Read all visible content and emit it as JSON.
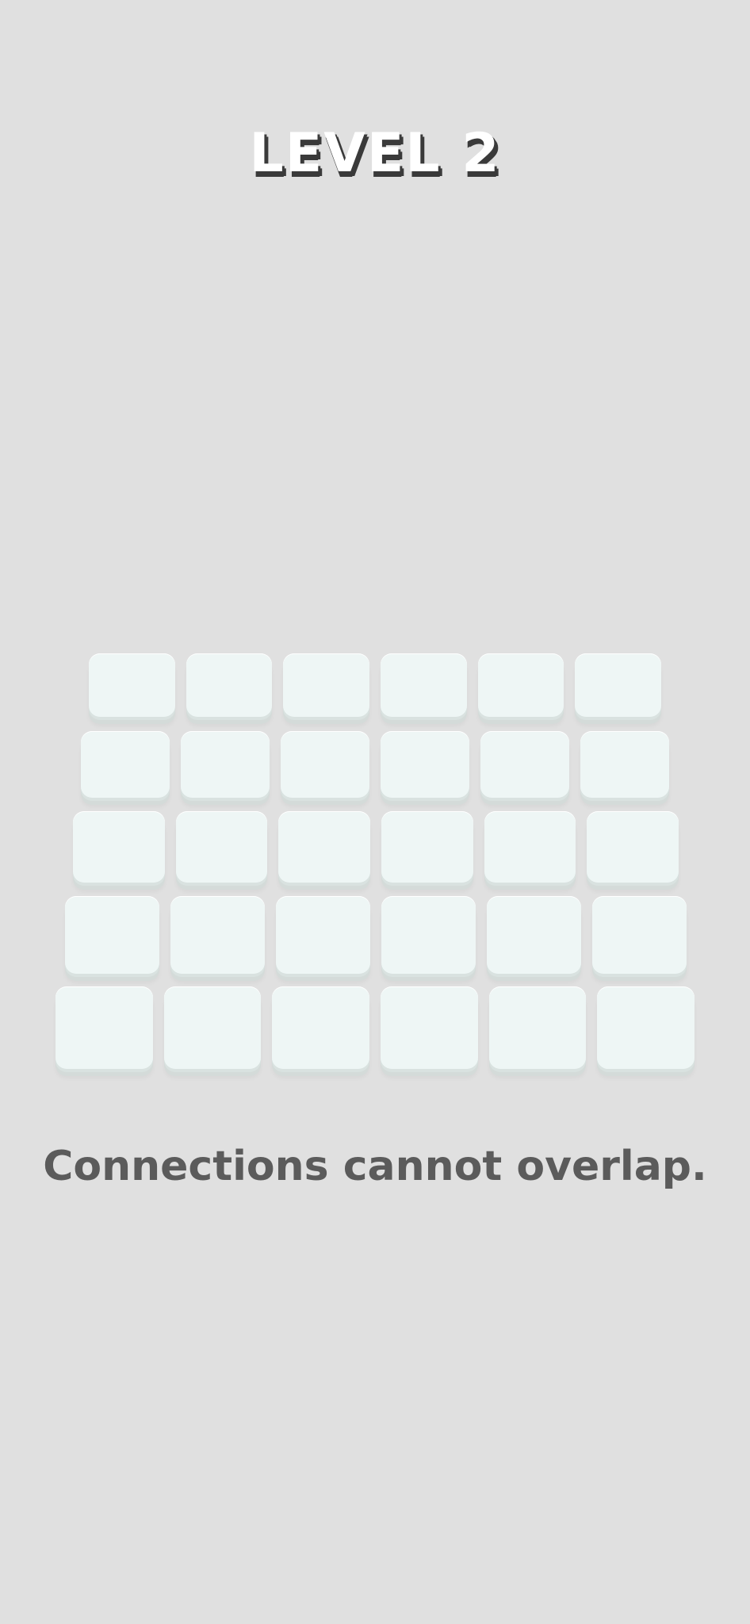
{
  "level": {
    "title": "LEVEL 2"
  },
  "board": {
    "rows": 5,
    "cols": 6
  },
  "hint": {
    "text": "Connections cannot overlap."
  },
  "colors": {
    "background": "#e0e0e0",
    "tile": "#eef6f5",
    "hint_text": "#5b5b5b",
    "title_text": "#ffffff",
    "title_shadow": "#3a3a3a"
  }
}
